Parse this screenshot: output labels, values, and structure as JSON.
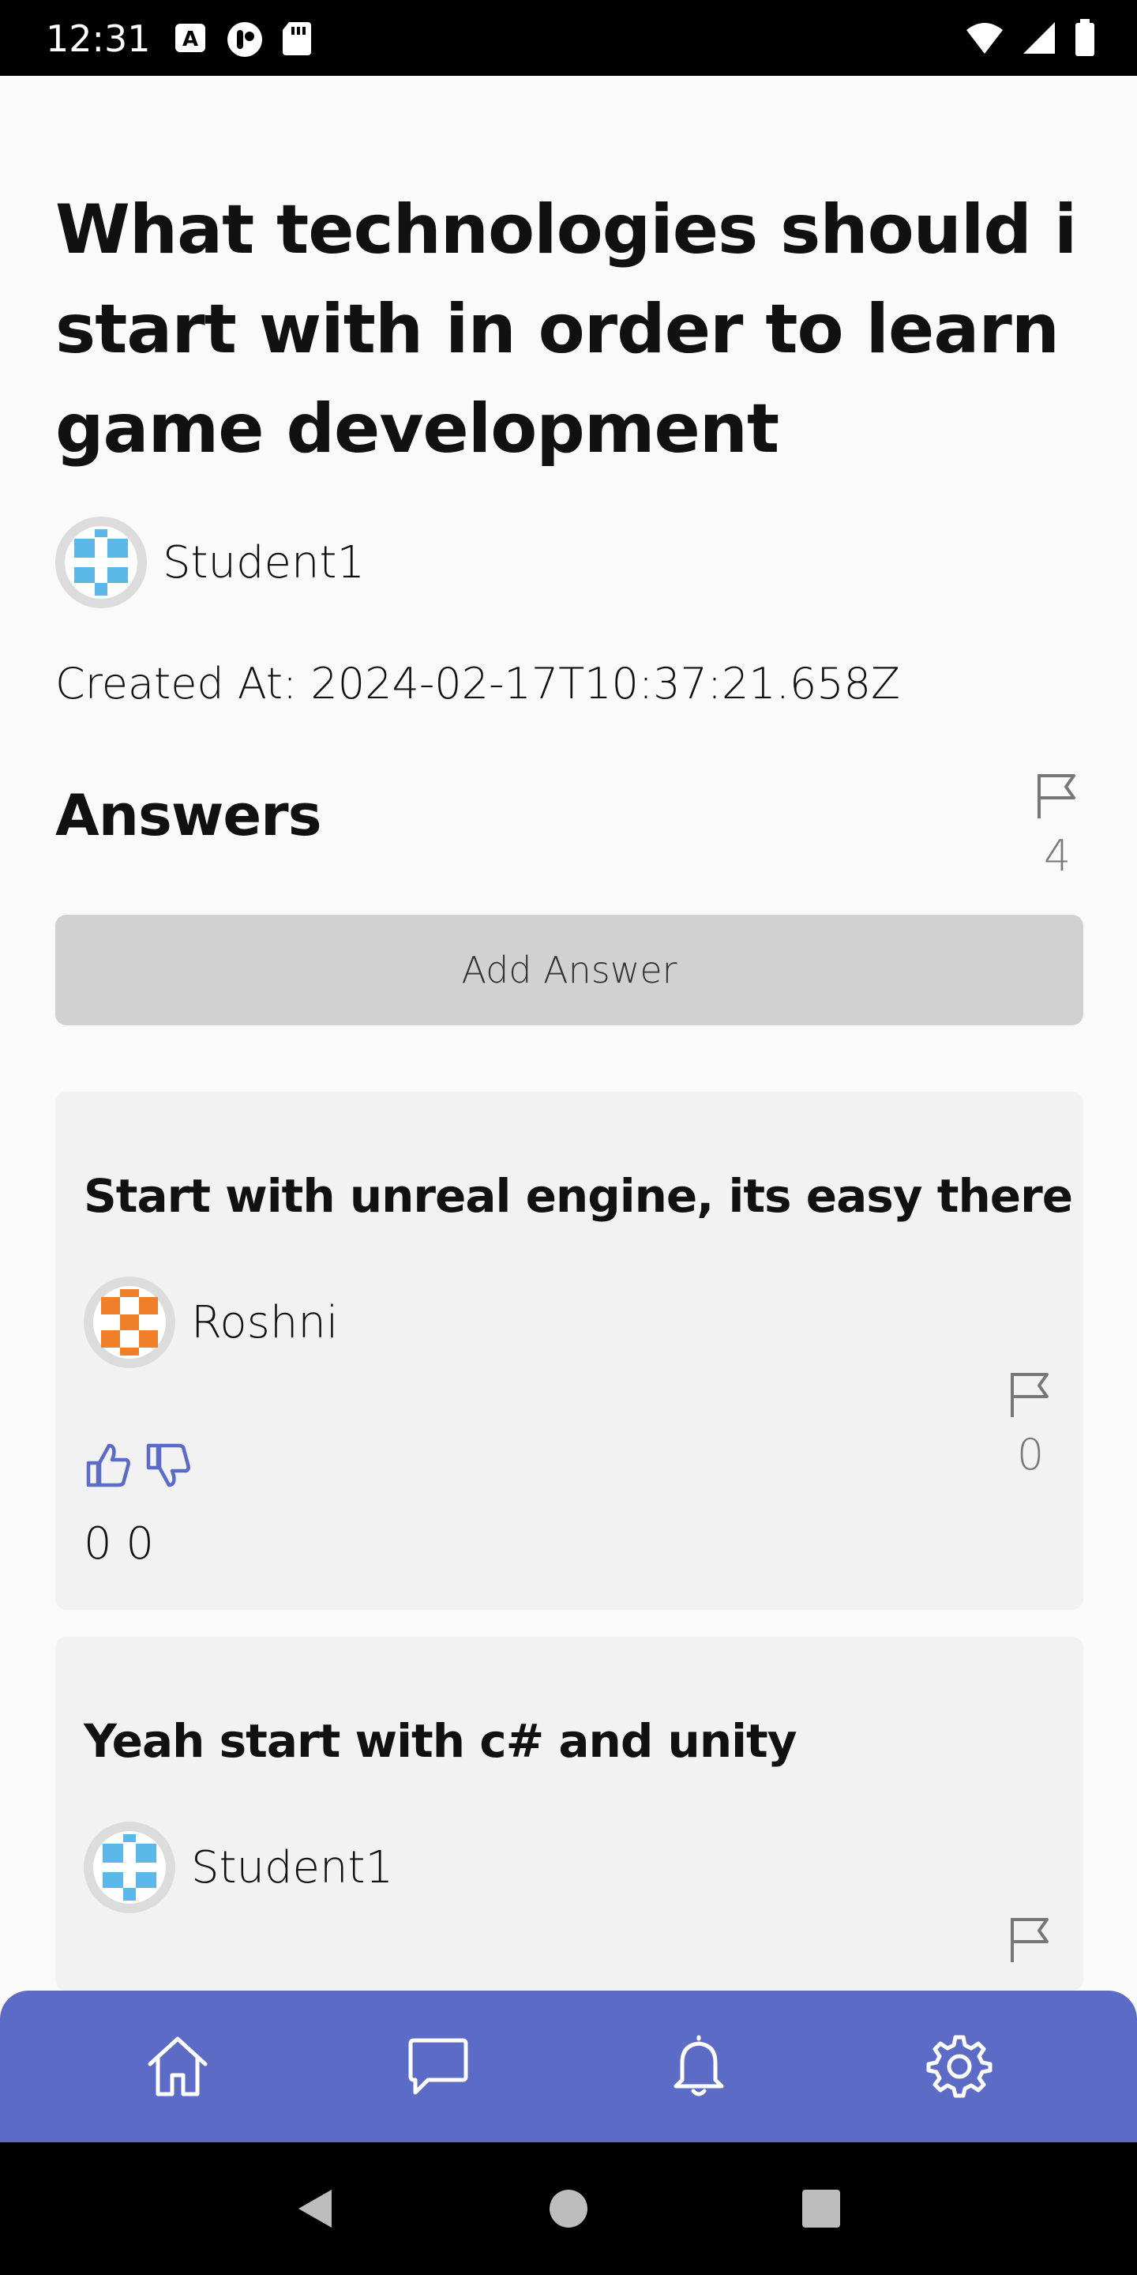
{
  "status_bar": {
    "time": "12:31"
  },
  "question": {
    "title": "What technologies should i start with in order to learn game development",
    "author": "Student1",
    "created_at": "Created At: 2024-02-17T10:37:21.658Z"
  },
  "answers_section": {
    "heading": "Answers",
    "flag_count": "4",
    "add_answer_label": "Add Answer"
  },
  "answers": [
    {
      "text": "Start with unreal engine, its easy there",
      "author": "Roshni",
      "flag_count": "0",
      "votes": "0 0"
    },
    {
      "text": "Yeah start with c# and unity",
      "author": "Student1"
    }
  ],
  "colors": {
    "accent": "#5c6bc6",
    "student_avatar": "#5bb8e8",
    "roshni_avatar": "#f07f2a"
  },
  "bottom_nav": [
    "home-icon",
    "chat-icon",
    "bell-icon",
    "gear-icon"
  ]
}
